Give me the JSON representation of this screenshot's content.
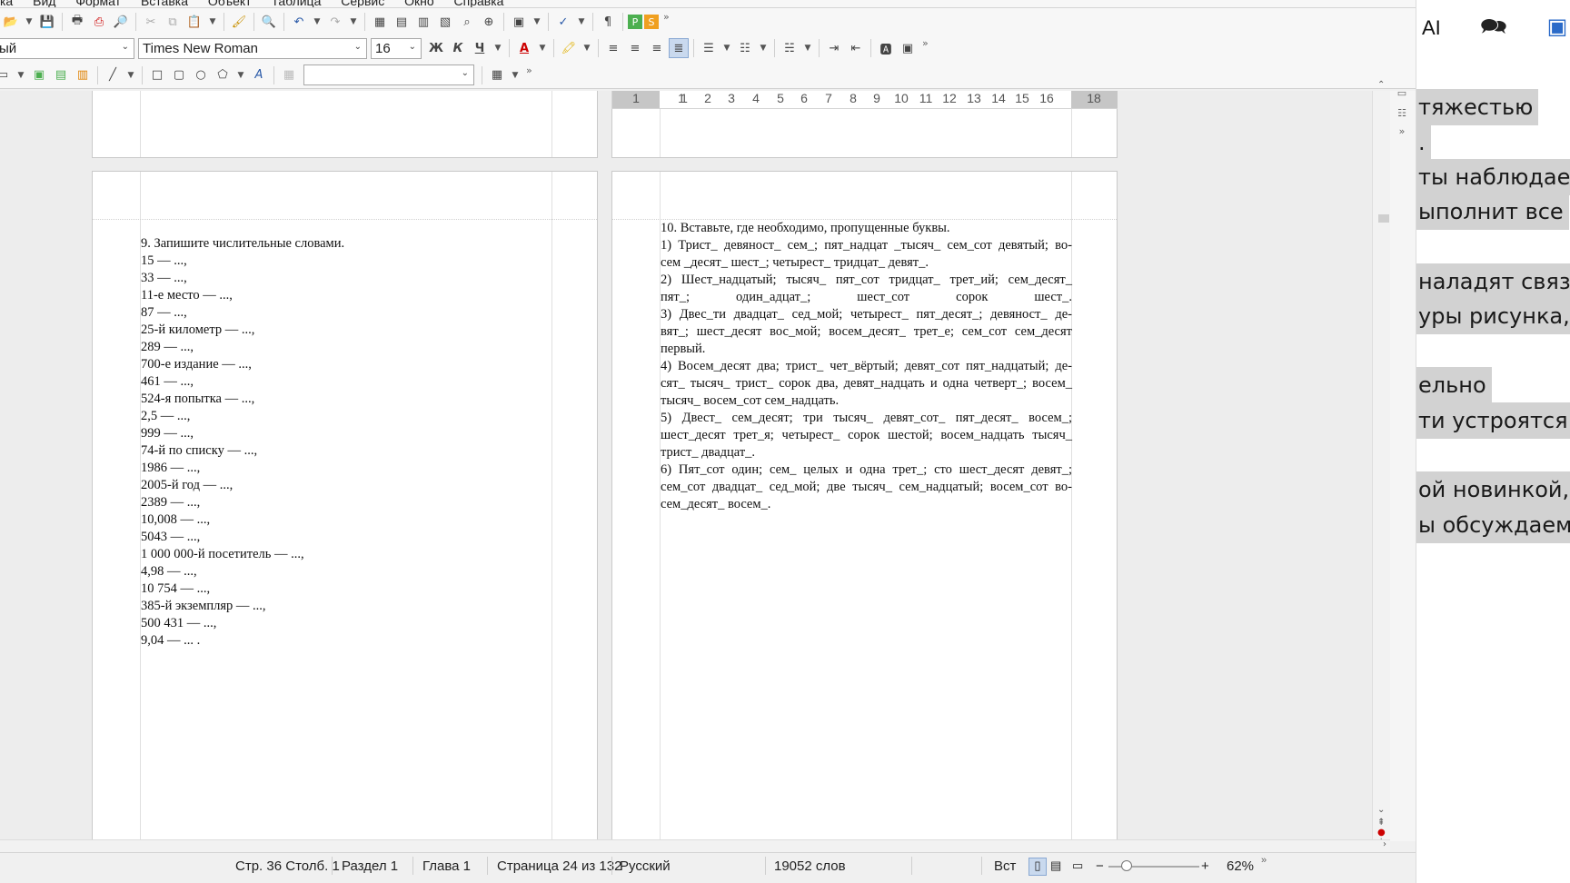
{
  "menubar": [
    "ка",
    "Вид",
    "Формат",
    "Вставка",
    "Объект",
    "Таблица",
    "Сервис",
    "Окно",
    "Справка"
  ],
  "toolbar2": {
    "style_value": "ый",
    "font_value": "Times New Roman",
    "size_value": "16",
    "bold_label": "Ж",
    "italic_label": "К",
    "underline_label": "Ч"
  },
  "toolbar3": {
    "frame_combo_value": ""
  },
  "ruler": {
    "labels": [
      "1",
      "1",
      "1",
      "2",
      "3",
      "4",
      "5",
      "6",
      "7",
      "8",
      "9",
      "10",
      "11",
      "12",
      "13",
      "14",
      "15",
      "16",
      "18"
    ]
  },
  "left_page": {
    "lines": [
      "9. Запишите числительные словами.",
      "15 — ...,",
      "33 — ...,",
      "11-е место — ...,",
      "87 — ...,",
      "25-й километр — ...,",
      "289 — ...,",
      "700-е издание — ...,",
      "461 — ...,",
      "524-я попытка — ...,",
      "2,5 — ...,",
      "999 — ...,",
      "74-й по списку — ...,",
      "1986 — ...,",
      "2005-й год — ...,",
      "2389 — ...,",
      "10,008 — ...,",
      "5043 — ...,",
      "1 000 000-й посетитель — ...,",
      "4,98 — ...,",
      "10 754 — ...,",
      "385-й экземпляр — ...,",
      "500 431 — ...,",
      "9,04 — ... ."
    ]
  },
  "right_page": {
    "lines": [
      "10. Вставьте, где необходимо, пропущенные буквы.",
      "1) Трист_ девяност_ сем_; пят_надцат _тысяч_ сем_сот девятый; во-",
      "сем _десят_ шест_; четырест_ тридцат_ девят_.",
      "2) Шест_надцатый; тысяч_ пят_сот тридцат_ трет_ий; сем_десят_",
      "пят_; один_адцат_; шест_сот сорок шест_.",
      "3) Двес_ти двадцат_ сед_мой; четырест_ пят_десят_; девяност_ де-",
      "вят_; шест_десят вос_мой; восем_десят_ трет_е; сем_сот сем_десят",
      "первый.",
      "4) Восем_десят два; трист_ чет_вёртый; девят_сот пят_надцатый; де-",
      "сят_ тысяч_ трист_ сорок два, девят_надцать и одна четверт_; восем_",
      "тысяч_ восем_сот сем_надцать.",
      "5) Двест_ сем_десят; три тысяч_ девят_сот_ пят_десят_ восем_;",
      "шест_десят трет_я; четырест_ сорок шестой; восем_надцать тысяч_",
      "трист_ двадцат_.",
      "6) Пят_сот один; сем_ целых и одна трет_; сто шест_десят девят_;",
      "сем_сот двадцат_ сед_мой; две тысяч_ сем_надцатый; восем_сот во-",
      "сем_десят_ восем_."
    ],
    "last_line_indices": [
      2,
      7,
      10,
      13,
      16
    ]
  },
  "statusbar": {
    "position": "Стр. 36 Столб. 1",
    "section": "Раздел 1",
    "chapter": "Глава 1",
    "page": "Страница 24 из 132",
    "language": "Русский",
    "words": "19052 слов",
    "insert_mode": "Вст",
    "zoom": "62%"
  },
  "overlay": {
    "ai_label": "AI",
    "lines": [
      "тяжестью",
      ".",
      "ты наблюдаеш",
      "ыполнит все",
      "наладят связь",
      "уры рисунка, т",
      "ельно",
      "ти устроятся",
      "ой новинкой,",
      "ы обсуждаем"
    ]
  }
}
